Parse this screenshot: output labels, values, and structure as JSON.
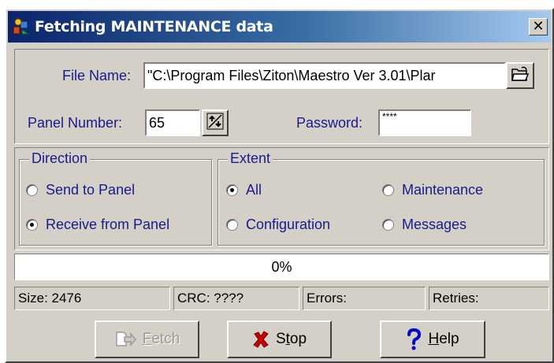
{
  "window": {
    "title": "Fetching MAINTENANCE data",
    "close_glyph": "✕"
  },
  "form": {
    "file_name_label": "File Name:",
    "file_name_value": "\"C:\\Program Files\\Ziton\\Maestro Ver 3.01\\Plar",
    "panel_number_label": "Panel Number:",
    "panel_number_value": "65",
    "password_label": "Password:",
    "password_value": "****"
  },
  "direction": {
    "title": "Direction",
    "options": [
      {
        "label": "Send to Panel",
        "checked": false
      },
      {
        "label": "Receive from Panel",
        "checked": true
      }
    ]
  },
  "extent": {
    "title": "Extent",
    "options": [
      {
        "label": "All",
        "checked": true
      },
      {
        "label": "Maintenance",
        "checked": false
      },
      {
        "label": "Configuration",
        "checked": false
      },
      {
        "label": "Messages",
        "checked": false
      }
    ]
  },
  "progress": {
    "text": "0%",
    "value": 0
  },
  "status": {
    "size": "Size: 2476",
    "crc": "CRC: ????",
    "errors": "Errors:",
    "retries": "Retries:"
  },
  "buttons": {
    "fetch_first": "F",
    "fetch_rest": "etch",
    "stop_first": "S",
    "stop_mid": "t",
    "stop_rest": "op",
    "help_first": "H",
    "help_rest": "elp",
    "fetch_enabled": false
  },
  "icons": {
    "title": "app-icon",
    "browse": "folder-open-icon",
    "spinner": "spinner-icon",
    "fetch": "fetch-icon",
    "stop": "x-icon",
    "help": "question-mark-icon"
  },
  "colors": {
    "label_text": "#1a1a8a",
    "stop_icon": "#cc0000",
    "help_icon": "#0000cc",
    "titlebar_start": "#0a246a",
    "titlebar_end": "#a6caf0"
  }
}
